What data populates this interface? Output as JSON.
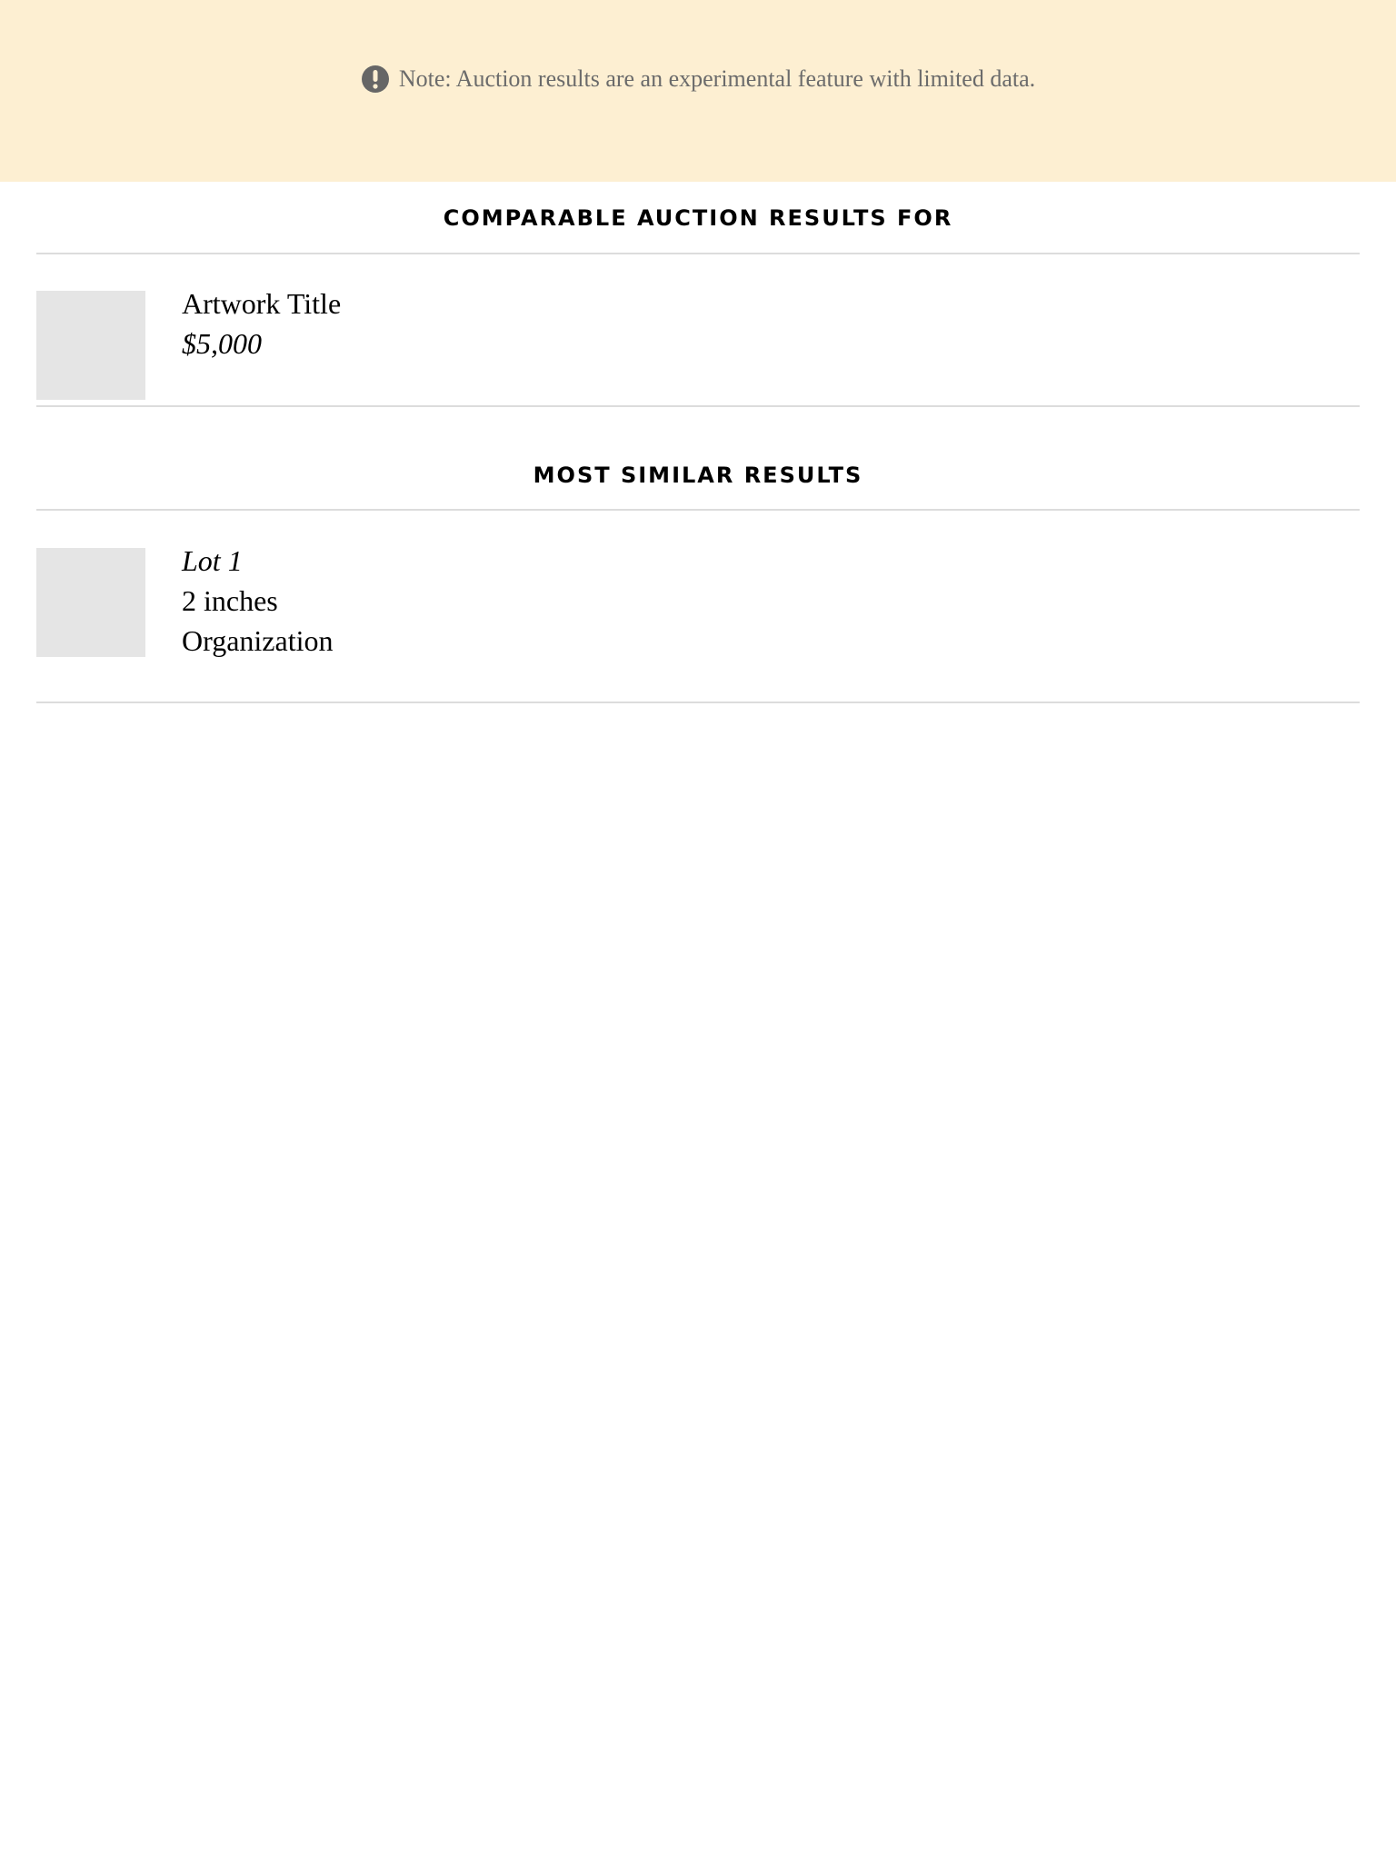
{
  "notice": {
    "icon": "exclamation-icon",
    "text": "Note: Auction results are an experimental feature with limited data.",
    "background": "#fdefd2"
  },
  "comparable": {
    "title": "COMPARABLE AUCTION RESULTS FOR",
    "artwork": {
      "title": "Artwork Title",
      "price": "$5,000"
    }
  },
  "similar": {
    "title": "MOST SIMILAR RESULTS",
    "results": [
      {
        "lot": "Lot 1",
        "dimensions": "2 inches",
        "organization": "Organization"
      }
    ]
  }
}
